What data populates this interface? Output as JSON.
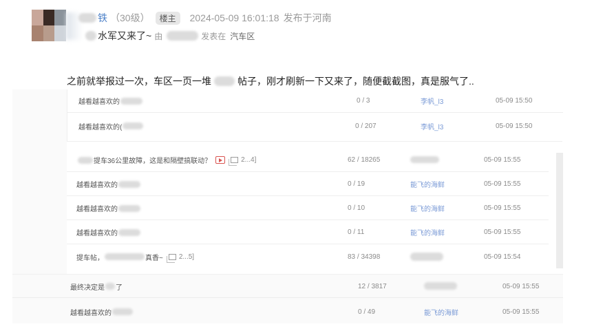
{
  "header": {
    "author_name": "铁",
    "author_level": "（30级）",
    "badge": "楼主",
    "timestamp": "2024-05-09 16:01:18",
    "location_text": "发布于河南",
    "sub_title": "水军又来了~",
    "sub_by": "由",
    "sub_posted_in": "发表在",
    "board": "汽车区"
  },
  "post": {
    "body_part1": "之前就举报过一次，车区一页一堆",
    "body_part2": "帖子，刚才刷新一下又来了，随便截截图，真是服气了.."
  },
  "screenshot_rows": {
    "group1": [
      {
        "title": "越看越喜欢的",
        "count": "0 / 3",
        "author": "李帆_l3",
        "date": "05-09 15:50"
      },
      {
        "title": "越看越喜欢的(",
        "count": "0 / 207",
        "author": "李帆_l3",
        "date": "05-09 15:50"
      }
    ],
    "group2": [
      {
        "title": "提车36公里故障，这是和隔壁搞联动？",
        "pages": "2...4]",
        "count": "62 / 18265",
        "author": "",
        "date": "05-09 15:55"
      },
      {
        "title": "越看越喜欢的",
        "count": "0 / 19",
        "author": "能飞的海鲜",
        "date": "05-09 15:55"
      },
      {
        "title": "越看越喜欢的",
        "count": "0 / 10",
        "author": "能飞的海鲜",
        "date": "05-09 15:55"
      },
      {
        "title": "越看越喜欢的",
        "count": "0 / 11",
        "author": "能飞的海鲜",
        "date": "05-09 15:55"
      },
      {
        "title": "提车帖，",
        "title_tail": "真香~",
        "pages": "2...5]",
        "count": "83 / 34398",
        "author": "",
        "date": "05-09 15:54"
      }
    ],
    "group3": [
      {
        "title": "最终决定是",
        "title_tail": "了",
        "count": "12 / 3817",
        "author": "",
        "date": "05-09 15:55"
      },
      {
        "title": "越看越喜欢的",
        "count": "0 / 49",
        "author": "能飞的海鲜",
        "date": "05-09 15:55"
      }
    ]
  },
  "colors": {
    "author_link": "#4a7fc7",
    "row_author_link": "#7a9ad6",
    "video_icon": "#d9534f"
  },
  "icons": {
    "video": "video-play-icon",
    "images": "image-gallery-icon"
  }
}
